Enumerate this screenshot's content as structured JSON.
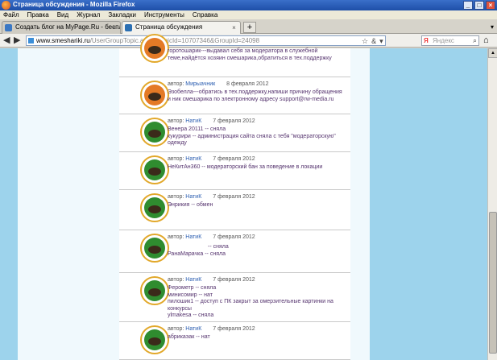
{
  "window": {
    "title": "Страница обсуждения - Mozilla Firefox",
    "minimize": "_",
    "maximize": "□",
    "close": "×"
  },
  "menu": [
    "Файл",
    "Правка",
    "Вид",
    "Журнал",
    "Закладки",
    "Инструменты",
    "Справка"
  ],
  "tabs": [
    {
      "label": "Создать блог на MyPage.Ru - бесплат...",
      "active": false
    },
    {
      "label": "Страница обсуждения",
      "active": true
    }
  ],
  "tab_close": "×",
  "new_tab": "+",
  "tab_list": "▾",
  "nav": {
    "back": "◀",
    "forward": "▶",
    "url_host": "www.smeshariki.ru",
    "url_path": "/UserGroupTopic.aspx?TopicId=10707346&GroupId=24098",
    "url_icons": [
      "☆",
      "&",
      "▾"
    ],
    "search_engine_letter": "Я",
    "search_placeholder": "Яндекс",
    "search_go": "⌕",
    "home": "⌂"
  },
  "author_prefix": "автор:",
  "posts": [
    {
      "author": "",
      "date": "",
      "lines": [
        "горотошарик---выдавал себя за модератора в служебной",
        "теме,найдётся хозяин смешарика,обратиться в тех.поддержку"
      ],
      "avatar": "alt"
    },
    {
      "author": "Мирыачник",
      "date": "8 февраля 2012",
      "lines": [
        "Эзобелла---обратись в тех.поддержку,напиши причину обращения",
        "и ник смешарика по электронному адресу support@rw-media.ru"
      ],
      "avatar": "alt"
    },
    {
      "author": "НатиК",
      "date": "7 февраля 2012",
      "lines": [
        "Венера 20111 -- сняла",
        "кукурири -- администрация сайта сняла с тебя \"модераторскую\"",
        "одежду"
      ],
      "avatar": "green"
    },
    {
      "author": "НатиК",
      "date": "7 февраля 2012",
      "lines": [
        "НеКитАн360 -- модераторский бан за поведение в локации"
      ],
      "avatar": "green"
    },
    {
      "author": "НатиК",
      "date": "7 февраля 2012",
      "lines": [
        "Энрикия -- обмен"
      ],
      "avatar": "green"
    },
    {
      "author": "НатиК",
      "date": "7 февраля 2012",
      "lines": [
        "-- сняла",
        "РанаМарачка -- сняла"
      ],
      "avatar": "green"
    },
    {
      "author": "НатиК",
      "date": "7 февраля 2012",
      "lines": [
        "Ферометр -- сняла",
        "минисомир -- нат",
        "пилошик1 -- доступ с ПК закрыт за омерзительные картинки на",
        "конкурсы",
        "ylmakesa -- сняла"
      ],
      "avatar": "green"
    },
    {
      "author": "НатиК",
      "date": "7 февраля 2012",
      "lines": [
        "абрикаэак -- нат"
      ],
      "avatar": "green"
    }
  ]
}
